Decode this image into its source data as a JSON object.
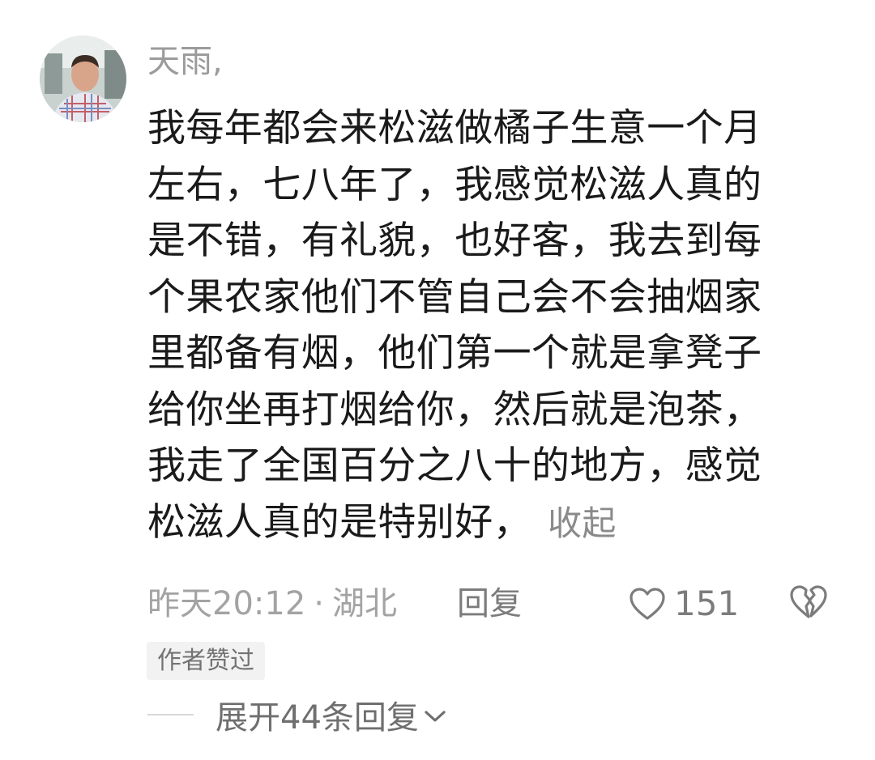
{
  "comment": {
    "username": "天雨,",
    "avatar_icon": "user-avatar-photo",
    "body_lines": [
      "我每年都会来松滋做橘子生意一个月",
      "左右，七八年了，我感觉松滋人真的",
      "是不错，有礼貌，也好客，我去到每",
      "个果农家他们不管自己会不会抽烟家",
      "里都备有烟，他们第一个就是拿凳子",
      "给你坐再打烟给你，然后就是泡茶，",
      "我走了全国百分之八十的地方，感觉",
      "松滋人真的是特别好，"
    ],
    "collapse_label": "收起",
    "time": "昨天20:12",
    "dot": "·",
    "location": "湖北",
    "reply_label": "回复",
    "like_icon": "heart-outline-icon",
    "like_count": "151",
    "dislike_icon": "broken-heart-icon",
    "author_badge": "作者赞过",
    "expand_label": "展开44条回复",
    "expand_icon": "chevron-down-icon"
  },
  "colors": {
    "text": "#1a1a1a",
    "meta": "#a3a3a3",
    "action": "#7c7c7c",
    "badge_bg": "#f2f2f2"
  }
}
